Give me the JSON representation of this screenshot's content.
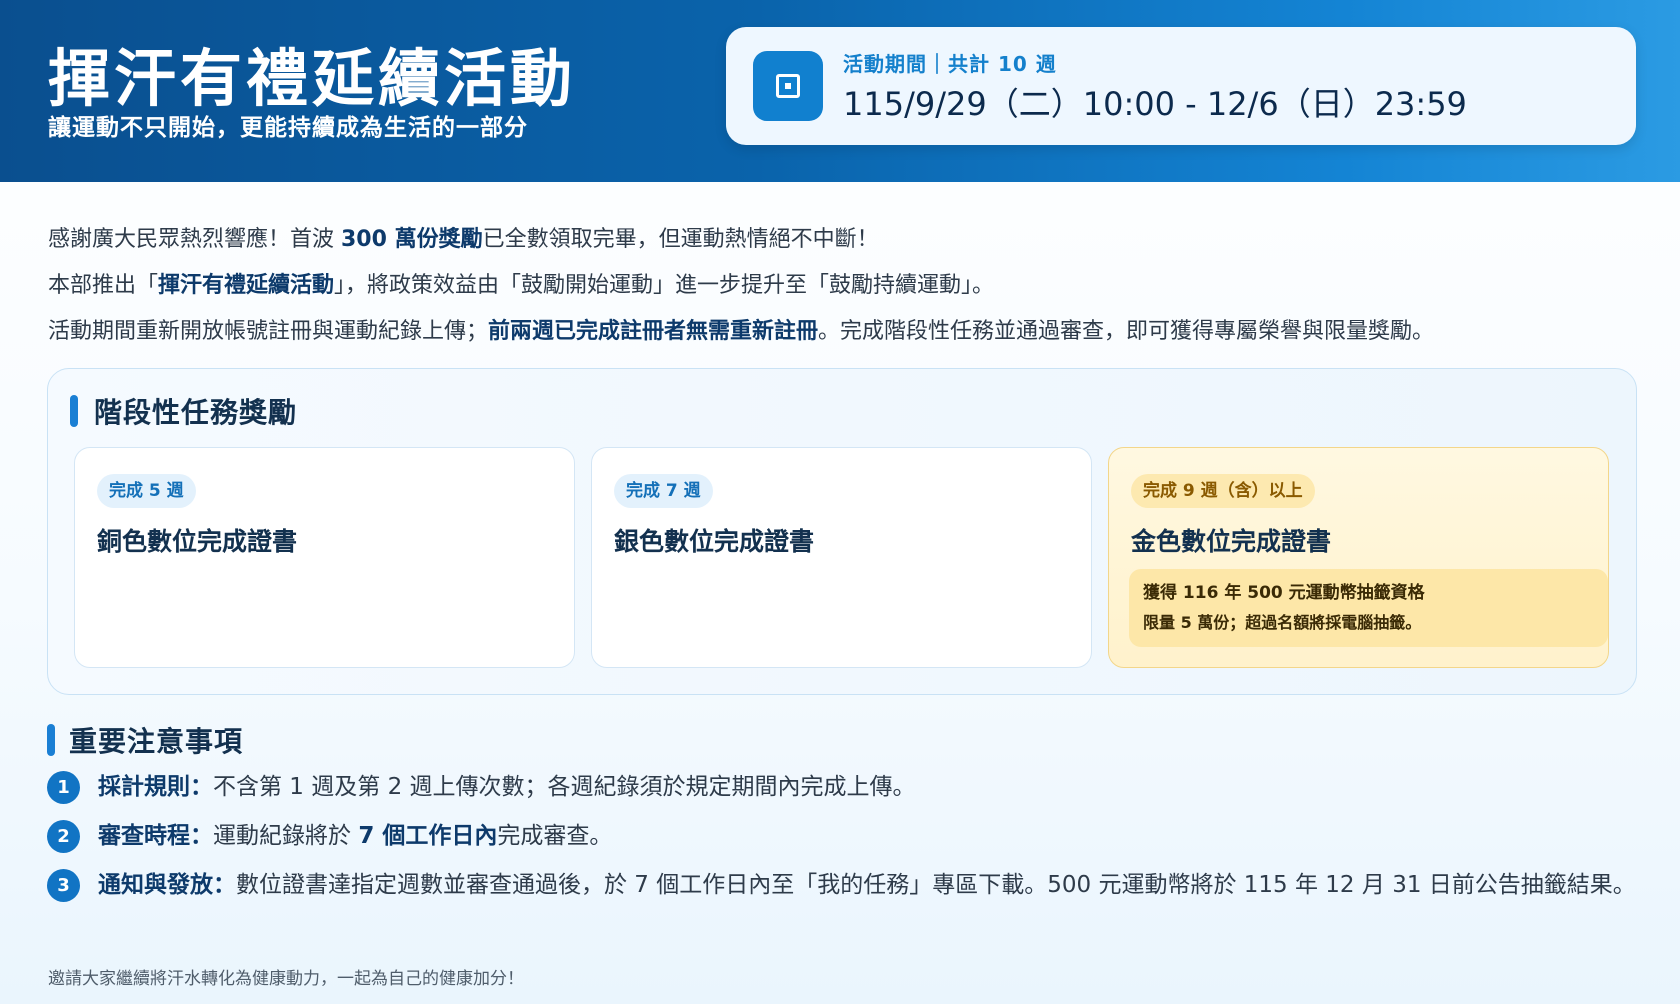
{
  "header": {
    "title": "揮汗有禮延續活動",
    "subtitle": "讓運動不只開始，更能持續成為生活的一部分",
    "period_label": "活動期間｜共計 10 週",
    "period_value": "115/9/29（二）10:00 - 12/6（日）23:59",
    "period_icon": "calendar-icon"
  },
  "intro": {
    "line1_a": "感謝廣大民眾熱烈響應！首波 ",
    "line1_b": "300 萬份獎勵",
    "line1_c": "已全數領取完畢，但運動熱情絕不中斷！",
    "line2_a": "本部推出「",
    "line2_b": "揮汗有禮延續活動",
    "line2_c": "」，將政策效益由「鼓勵開始運動」進一步提升至「鼓勵持續運動」。",
    "line3_a": "活動期間重新開放帳號註冊與運動紀錄上傳；",
    "line3_b": "前兩週已完成註冊者無需重新註冊",
    "line3_c": "。完成階段性任務並通過審查，即可獲得專屬榮譽與限量獎勵。"
  },
  "tiers": {
    "title": "階段性任務獎勵",
    "items": [
      {
        "badge": "完成 5 週",
        "name": "銅色數位完成證書"
      },
      {
        "badge": "完成 7 週",
        "name": "銀色數位完成證書"
      },
      {
        "badge": "完成 9 週（含）以上",
        "name": "金色數位完成證書",
        "note_line1": "獲得 116 年 500 元運動幣抽籤資格",
        "note_line2": "限量 5 萬份；超過名額將採電腦抽籤。"
      }
    ]
  },
  "notes": {
    "title": "重要注意事項",
    "items": [
      {
        "num": "1",
        "label": "採計規則：",
        "text": "不含第 1 週及第 2 週上傳次數；各週紀錄須於規定期間內完成上傳。"
      },
      {
        "num": "2",
        "label": "審查時程：",
        "text_a": "運動紀錄將於 ",
        "text_b": "7 個工作日內",
        "text_c": "完成審查。"
      },
      {
        "num": "3",
        "label": "通知與發放：",
        "text": "數位證書達指定週數並審查通過後，於 7 個工作日內至「我的任務」專區下載。500 元運動幣將於 115 年 12 月 31 日前公告抽籤結果。"
      }
    ]
  },
  "footer": "邀請大家繼續將汗水轉化為健康動力，一起為自己的健康加分！",
  "colors": {
    "header_bg": "#0a63ab",
    "accent": "#1a7fd4",
    "gold_card": "#fff2cc"
  }
}
